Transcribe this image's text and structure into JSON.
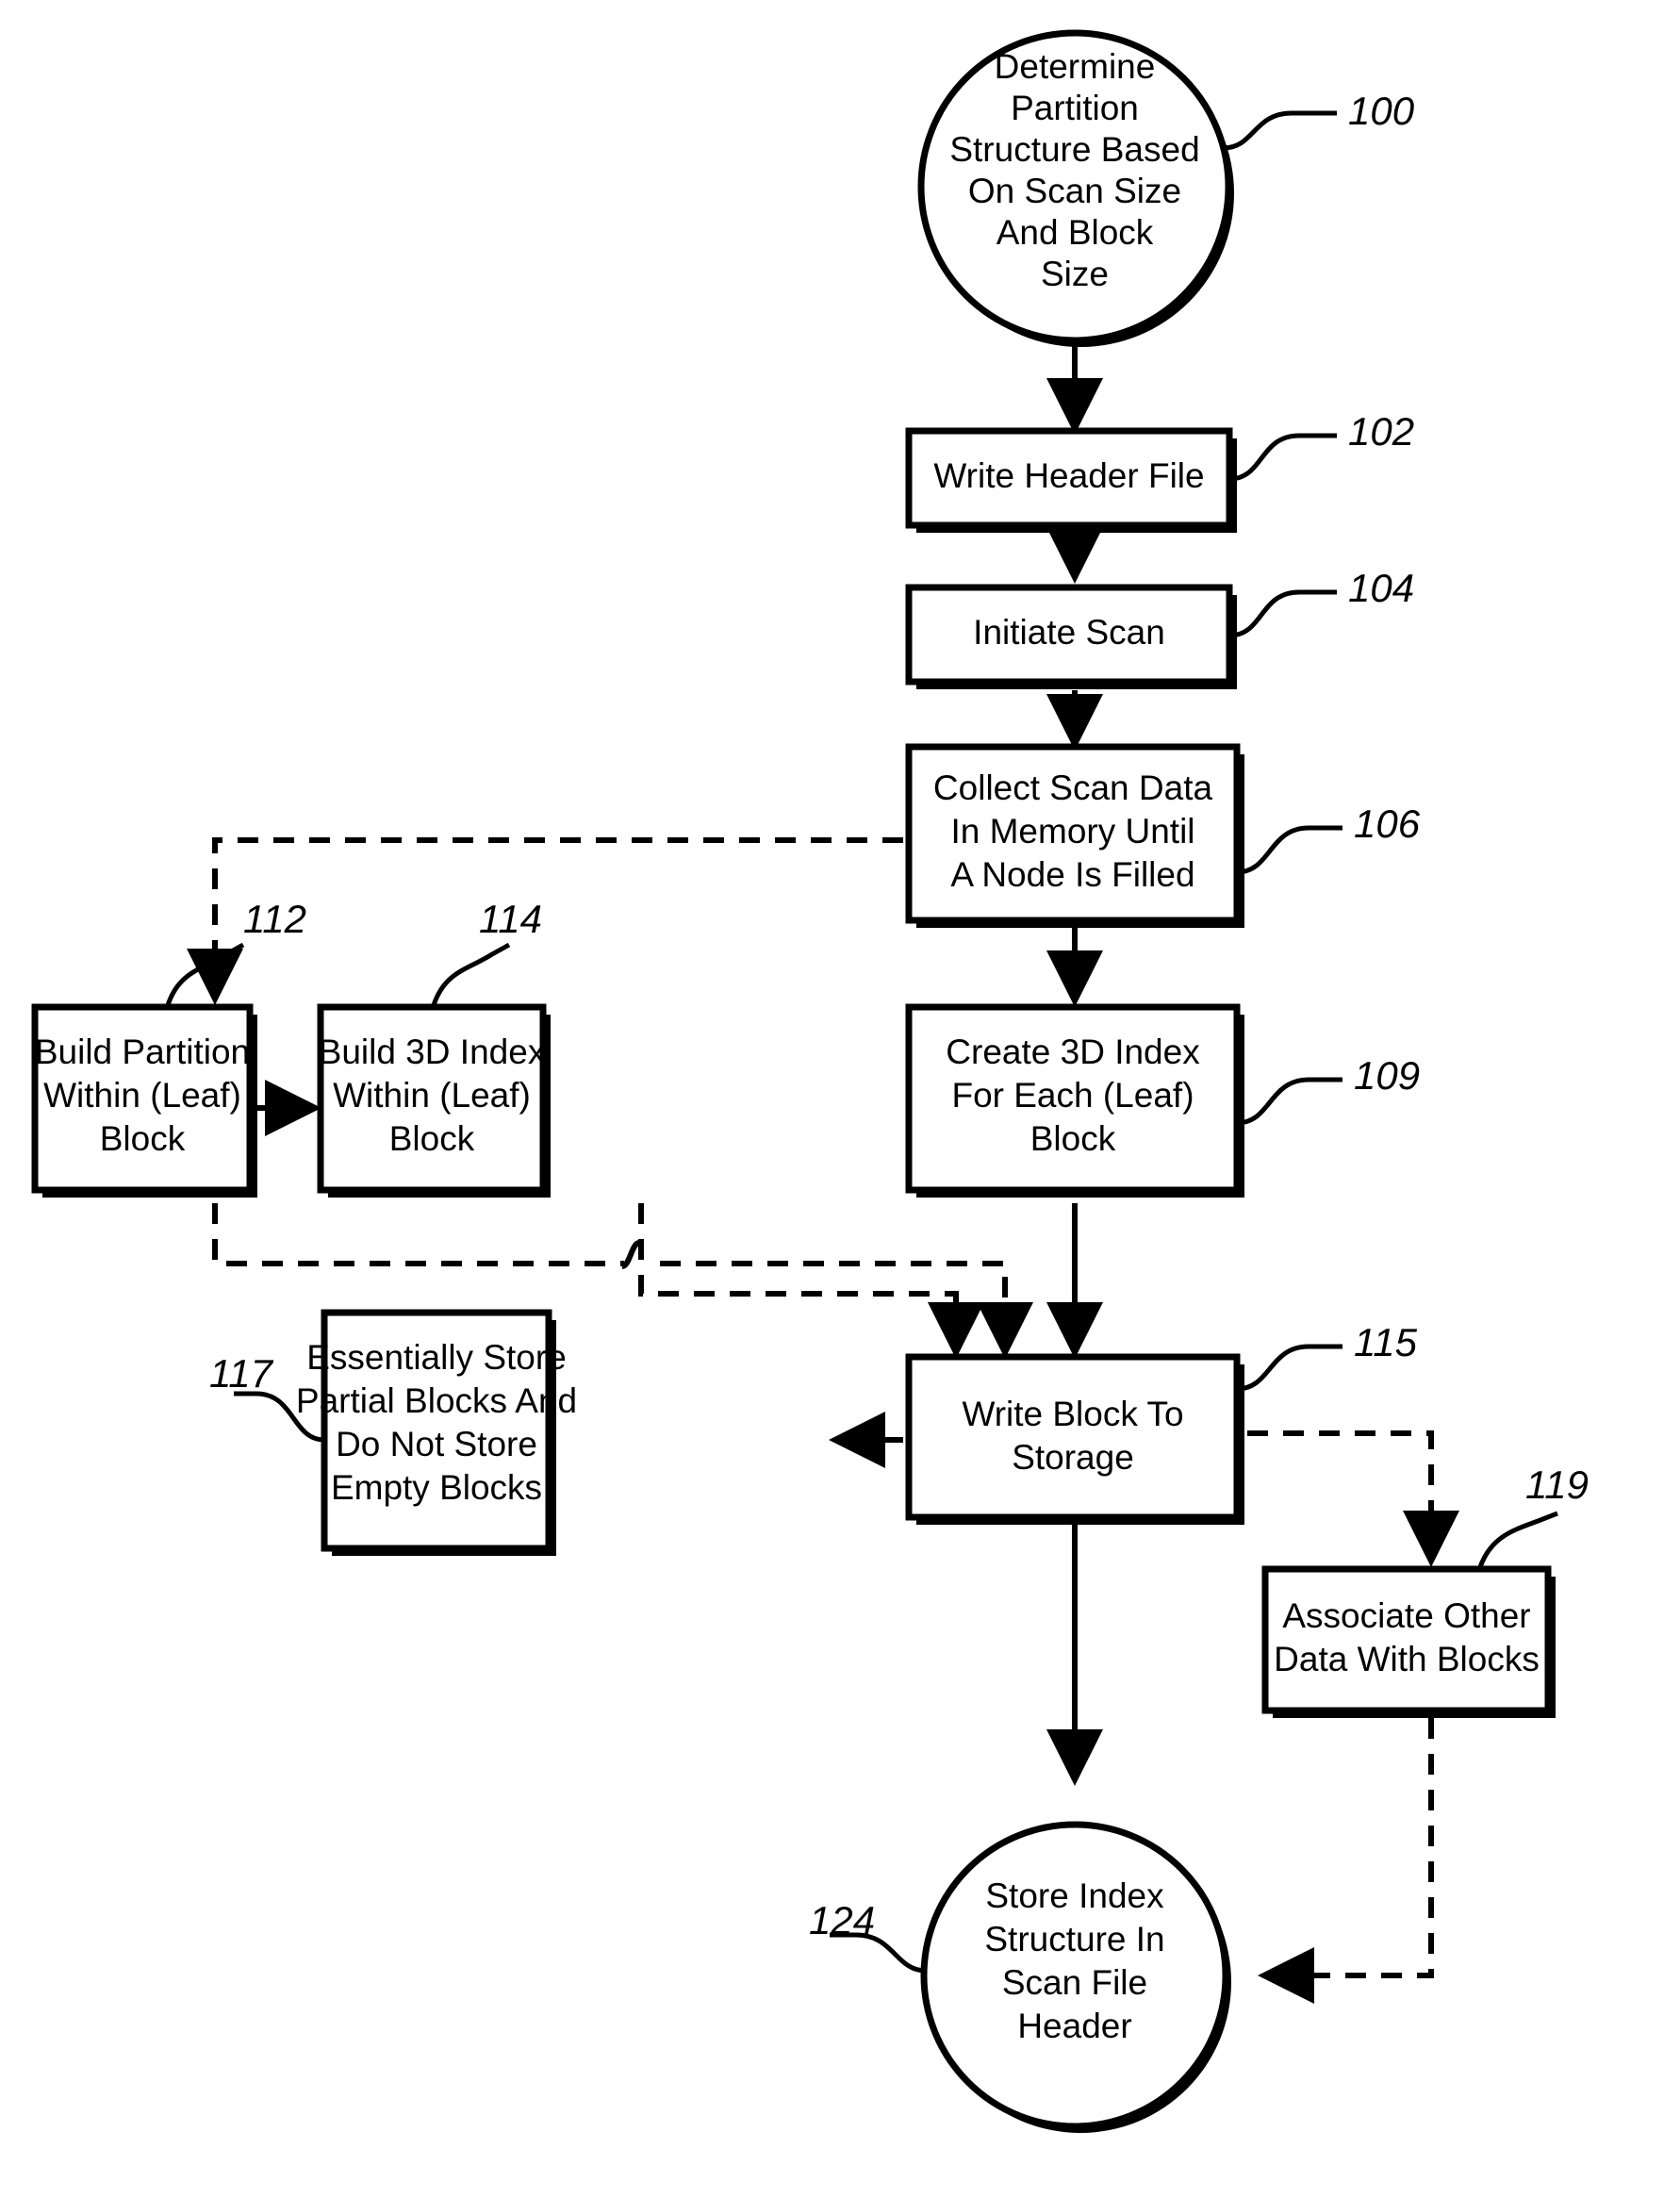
{
  "figure": {
    "type": "flowchart",
    "title": "",
    "background_color": "#ffffff",
    "line_color": "#000000"
  },
  "nodes": [
    {
      "id": "n100",
      "ref": "100",
      "shape": "circle",
      "lines": [
        "Determine",
        "Partition",
        "Structure Based",
        "On Scan Size",
        "And Block",
        "Size"
      ],
      "text": "Determine Partition Structure Based On Scan Size And Block Size"
    },
    {
      "id": "n102",
      "ref": "102",
      "shape": "rect",
      "lines": [
        "Write Header File"
      ],
      "text": "Write Header File"
    },
    {
      "id": "n104",
      "ref": "104",
      "shape": "rect",
      "lines": [
        "Initiate Scan"
      ],
      "text": "Initiate Scan"
    },
    {
      "id": "n106",
      "ref": "106",
      "shape": "rect",
      "lines": [
        "Collect Scan Data",
        "In Memory Until",
        "A Node Is Filled"
      ],
      "text": "Collect Scan Data In Memory Until A Node Is Filled"
    },
    {
      "id": "n112",
      "ref": "112",
      "shape": "rect",
      "lines": [
        "Build Partition",
        "Within (Leaf)",
        "Block"
      ],
      "text": "Build Partition Within (Leaf) Block"
    },
    {
      "id": "n114",
      "ref": "114",
      "shape": "rect",
      "lines": [
        "Build 3D Index",
        "Within (Leaf)",
        "Block"
      ],
      "text": "Build 3D Index Within (Leaf) Block"
    },
    {
      "id": "n109",
      "ref": "109",
      "shape": "rect",
      "lines": [
        "Create 3D Index",
        "For Each (Leaf)",
        "Block"
      ],
      "text": "Create 3D Index For Each (Leaf) Block"
    },
    {
      "id": "n117",
      "ref": "117",
      "shape": "rect",
      "lines": [
        "Essentially Store",
        "Partial Blocks And",
        "Do Not Store",
        "Empty Blocks"
      ],
      "text": "Essentially Store Partial Blocks And Do Not Store Empty Blocks"
    },
    {
      "id": "n115",
      "ref": "115",
      "shape": "rect",
      "lines": [
        "Write Block To",
        "Storage"
      ],
      "text": "Write Block To Storage"
    },
    {
      "id": "n119",
      "ref": "119",
      "shape": "rect",
      "lines": [
        "Associate Other",
        "Data With Blocks"
      ],
      "text": "Associate Other Data With Blocks"
    },
    {
      "id": "n124",
      "ref": "124",
      "shape": "circle",
      "lines": [
        "Store Index",
        "Structure In",
        "Scan File",
        "Header"
      ],
      "text": "Store Index Structure In Scan File Header"
    }
  ],
  "edges": [
    {
      "from": "n100",
      "to": "n102",
      "style": "solid"
    },
    {
      "from": "n102",
      "to": "n104",
      "style": "solid"
    },
    {
      "from": "n104",
      "to": "n106",
      "style": "solid"
    },
    {
      "from": "n106",
      "to": "n109",
      "style": "solid"
    },
    {
      "from": "n106",
      "to": "n112",
      "style": "dashed"
    },
    {
      "from": "n112",
      "to": "n114",
      "style": "dashed"
    },
    {
      "from": "n112",
      "to": "n115",
      "style": "dashed"
    },
    {
      "from": "n114",
      "to": "n115",
      "style": "dashed"
    },
    {
      "from": "n109",
      "to": "n115",
      "style": "solid"
    },
    {
      "from": "n115",
      "to": "n117",
      "style": "solid"
    },
    {
      "from": "n115",
      "to": "n119",
      "style": "dashed"
    },
    {
      "from": "n115",
      "to": "n124",
      "style": "solid"
    },
    {
      "from": "n119",
      "to": "n124",
      "style": "dashed"
    }
  ]
}
